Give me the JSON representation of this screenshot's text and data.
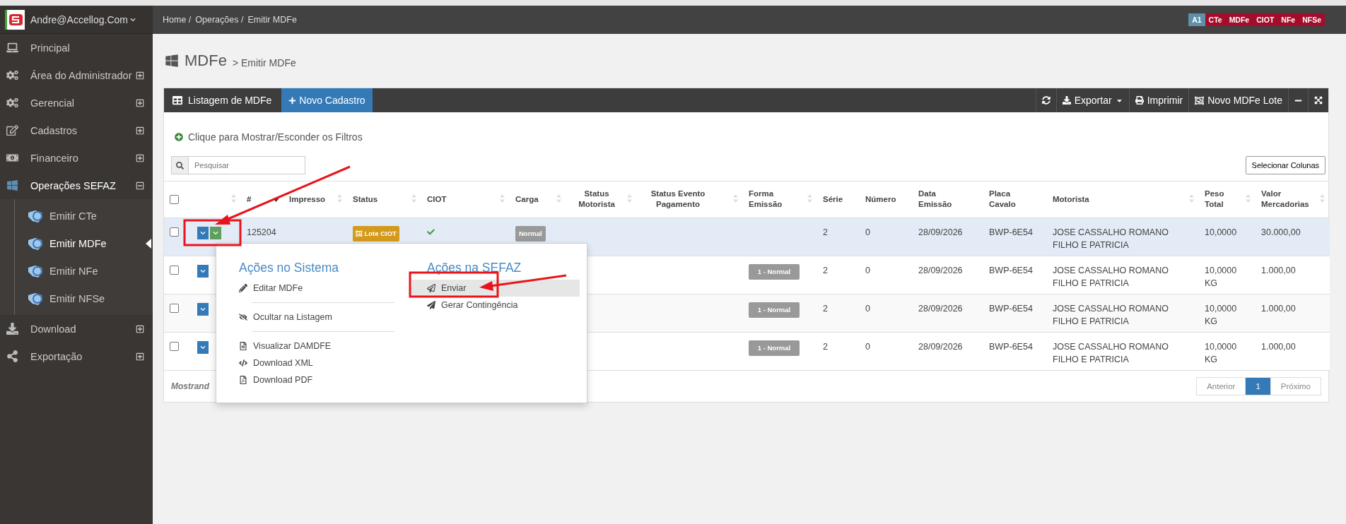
{
  "sidebar": {
    "user": "Andre@Accellog.Com",
    "items": [
      {
        "label": "Principal",
        "selected": false
      },
      {
        "label": "Área do Administrador",
        "expanded": false,
        "selected": false
      },
      {
        "label": "Gerencial",
        "expanded": false,
        "selected": false
      },
      {
        "label": "Cadastros",
        "expanded": false,
        "selected": false
      },
      {
        "label": "Financeiro",
        "expanded": false,
        "selected": false
      },
      {
        "label": "Operações SEFAZ",
        "expanded": true,
        "selected": true,
        "children": [
          {
            "label": "Emitir CTe",
            "selected": false
          },
          {
            "label": "Emitir MDFe",
            "selected": true
          },
          {
            "label": "Emitir NFe",
            "selected": false
          },
          {
            "label": "Emitir NFSe",
            "selected": false
          }
        ]
      },
      {
        "label": "Download",
        "expanded": false,
        "selected": false
      },
      {
        "label": "Exportação",
        "expanded": false,
        "selected": false
      }
    ]
  },
  "header": {
    "breadcrumb": [
      "Home /",
      "Operações /",
      "Emitir MDFe"
    ],
    "badges": [
      {
        "label": "A1",
        "color": "#5e91a9"
      },
      {
        "label": "CTe",
        "color": "#a30d2c"
      },
      {
        "label": "MDFe",
        "color": "#a30d2c"
      },
      {
        "label": "CIOT",
        "color": "#a30d2c"
      },
      {
        "label": "NFe",
        "color": "#a30d2c"
      },
      {
        "label": "NFSe",
        "color": "#a30d2c"
      }
    ]
  },
  "page": {
    "title": "MDFe",
    "subtitle": "> Emitir MDFe"
  },
  "toolbar": {
    "title": "Listagem de MDFe",
    "new_button": "Novo Cadastro",
    "export": "Exportar",
    "print": "Imprimir",
    "batch": "Novo MDFe Lote"
  },
  "filters_toggle": "Clique para Mostrar/Esconder os Filtros",
  "search": {
    "placeholder": "Pesquisar"
  },
  "columns_button": "Selecionar Colunas",
  "table": {
    "columns": [
      {
        "kind": "checkbox",
        "checked": false
      },
      {
        "kind": "sort",
        "sortable": true
      },
      {
        "label": "#",
        "sortable": true,
        "sorted": true
      },
      {
        "label": "Impresso",
        "sortable": true
      },
      {
        "label": "Status",
        "sortable": true
      },
      {
        "label": "CIOT",
        "sortable": true
      },
      {
        "label": "Carga",
        "sortable": true
      },
      {
        "label": "Status Motorista",
        "sortable": true
      },
      {
        "label": "Status Evento Pagamento",
        "sortable": true
      },
      {
        "label": "Forma Emissão",
        "sortable": true
      },
      {
        "label": "Série",
        "sortable": false
      },
      {
        "label": "Número",
        "sortable": false
      },
      {
        "label": "Data Emissão",
        "sortable": false
      },
      {
        "label": "Placa Cavalo",
        "sortable": false
      },
      {
        "label": "Motorista",
        "sortable": true
      },
      {
        "label": "Peso Total",
        "sortable": true
      },
      {
        "label": "Valor Mercadorias",
        "sortable": true
      }
    ],
    "rows": [
      {
        "selected": true,
        "checked": false,
        "actions": [
          {
            "color": "#337ab7"
          },
          {
            "color": "#5f9e5f"
          }
        ],
        "number": "125204",
        "status": {
          "label": "Lote CIOT",
          "color": "#d49a1a"
        },
        "ciot_ok": true,
        "carga": "Normal",
        "serie": "2",
        "numero": "0",
        "data": "28/09/2026",
        "placa": "BWP-6E54",
        "motorista": "JOSE CASSALHO ROMANO FILHO E PATRICIA",
        "peso": "10,0000",
        "valor": "30.000,00"
      },
      {
        "selected": false,
        "checked": false,
        "actions": [
          {
            "color": "#337ab7"
          }
        ],
        "forma": "1 - Normal",
        "serie": "2",
        "numero": "0",
        "data": "28/09/2026",
        "placa": "BWP-6E54",
        "motorista": "JOSE CASSALHO ROMANO FILHO E PATRICIA",
        "peso": "10,0000 KG",
        "valor": "1.000,00"
      },
      {
        "selected": false,
        "checked": false,
        "actions": [
          {
            "color": "#337ab7"
          }
        ],
        "forma": "1 - Normal",
        "serie": "2",
        "numero": "0",
        "data": "28/09/2026",
        "placa": "BWP-6E54",
        "motorista": "JOSE CASSALHO ROMANO FILHO E PATRICIA",
        "peso": "10,0000 KG",
        "valor": "1.000,00"
      },
      {
        "selected": false,
        "checked": false,
        "actions": [
          {
            "color": "#337ab7"
          }
        ],
        "forma": "1 - Normal",
        "serie": "2",
        "numero": "0",
        "data": "28/09/2026",
        "placa": "BWP-6E54",
        "motorista": "JOSE CASSALHO ROMANO FILHO E PATRICIA",
        "peso": "10,0000 KG",
        "valor": "1.000,00"
      }
    ],
    "footer": "Mostrand"
  },
  "pagination": [
    {
      "label": "Anterior",
      "selected": false
    },
    {
      "label": "1",
      "selected": true
    },
    {
      "label": "Próximo",
      "selected": false
    }
  ],
  "actions_menu": {
    "groups": [
      {
        "title": "Ações no Sistema",
        "sections": [
          [
            {
              "label": "Editar MDFe",
              "selected": false
            }
          ],
          [
            {
              "label": "Ocultar na Listagem",
              "selected": false
            }
          ],
          [
            {
              "label": "Visualizar DAMDFE",
              "selected": false
            },
            {
              "label": "Download XML",
              "selected": false
            },
            {
              "label": "Download PDF",
              "selected": false
            }
          ]
        ]
      },
      {
        "title": "Ações na SEFAZ",
        "sections": [
          [
            {
              "label": "Enviar",
              "selected": true
            },
            {
              "label": "Gerar Contingência",
              "selected": false
            }
          ]
        ]
      }
    ]
  }
}
